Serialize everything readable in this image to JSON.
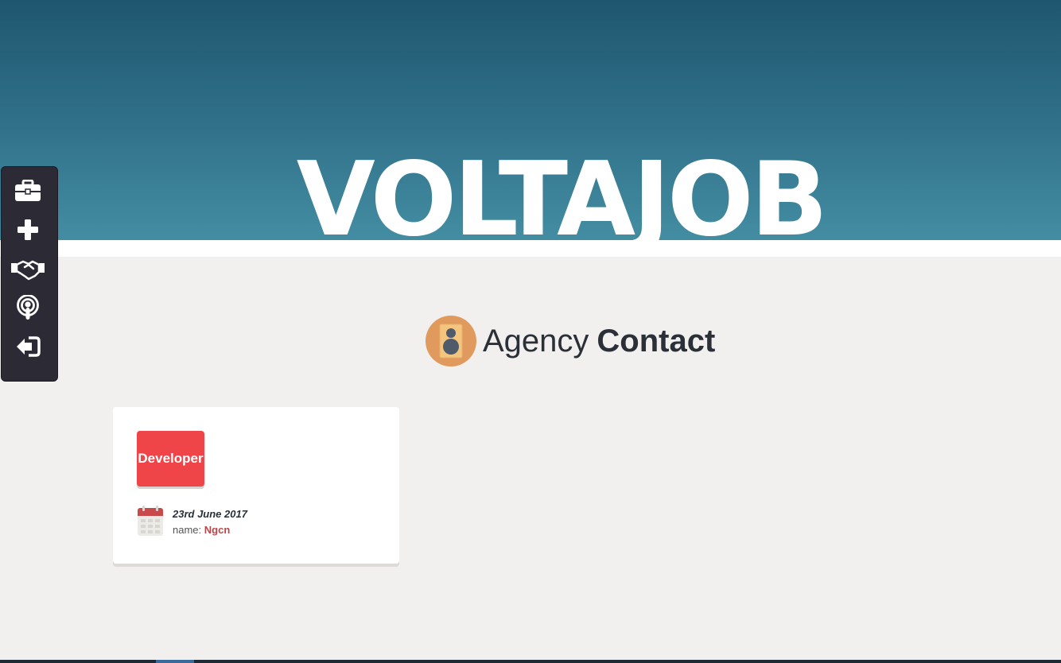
{
  "hero": {
    "title": "VOLTAJOB"
  },
  "sidebar": {
    "items": [
      {
        "icon": "briefcase-icon",
        "label": "Jobs"
      },
      {
        "icon": "plus-icon",
        "label": "Add"
      },
      {
        "icon": "handshake-icon",
        "label": "Agencies"
      },
      {
        "icon": "podcast-icon",
        "label": "Broadcast"
      },
      {
        "icon": "sign-out-icon",
        "label": "Logout"
      }
    ]
  },
  "section": {
    "title_light": "Agency",
    "title_bold": "Contact",
    "icon": "speaker-icon"
  },
  "card": {
    "badge": "Developer",
    "date": "23rd June 2017",
    "name_label": "name:",
    "name_value": "Ngcn",
    "icon": "calendar-icon"
  },
  "colors": {
    "hero_top": "#1f566f",
    "hero_bottom": "#438da2",
    "sidebar_bg": "#2b2a35",
    "badge_bg": "#ef4549",
    "accent_name": "#b8474b",
    "page_bg": "#f2f0ee"
  }
}
